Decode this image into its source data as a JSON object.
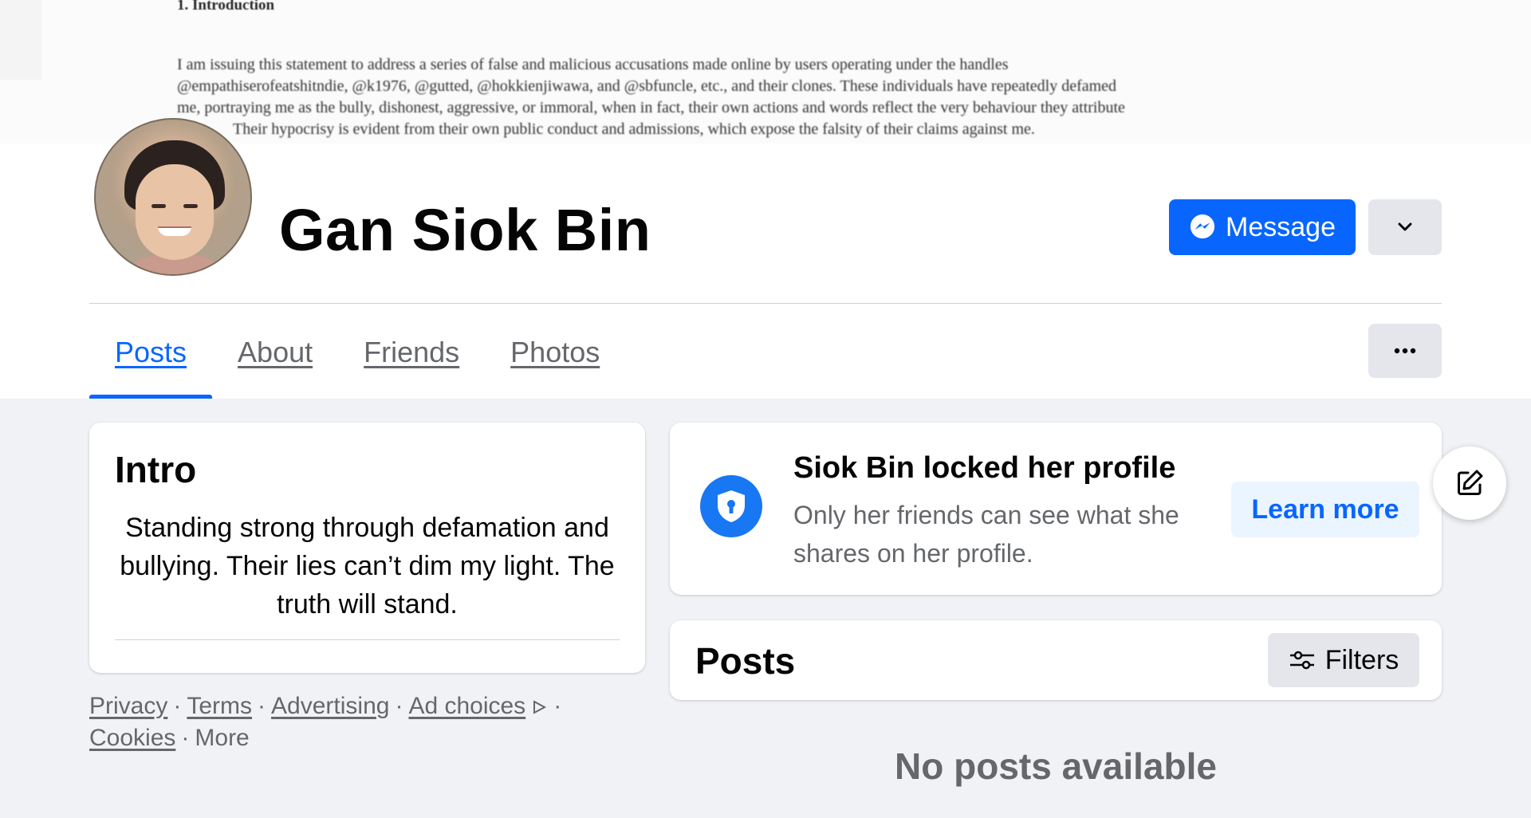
{
  "cover": {
    "heading": "1. Introduction",
    "paragraph_lines": [
      "I am issuing this statement to address a series of false and malicious accusations made online by users operating under the handles",
      "@empathiserofeatshitndie, @k1976, @gutted, @hokkienjiwawa, and @sbfuncle, etc., and their clones. These individuals have repeatedly defamed",
      "me, portraying me as the bully, dishonest, aggressive, or immoral, when in fact, their own actions and words reflect the very behaviour they attribute",
      "Their hypocrisy is evident from their own public conduct and admissions, which expose the falsity of their claims against me."
    ]
  },
  "profile": {
    "name": "Gan Siok Bin",
    "message_label": "Message"
  },
  "tabs": [
    {
      "label": "Posts",
      "active": true
    },
    {
      "label": "About",
      "active": false
    },
    {
      "label": "Friends",
      "active": false
    },
    {
      "label": "Photos",
      "active": false
    }
  ],
  "intro": {
    "title": "Intro",
    "bio": "Standing strong through defamation and bullying. Their lies can’t dim my light. The truth will stand."
  },
  "footer": {
    "links": [
      "Privacy",
      "Terms",
      "Advertising",
      "Ad choices",
      "Cookies"
    ],
    "more": "More",
    "separator": "·"
  },
  "locked": {
    "title": "Siok Bin locked her profile",
    "description": "Only her friends can see what she shares on her profile.",
    "learn_more": "Learn more"
  },
  "posts": {
    "title": "Posts",
    "filters_label": "Filters",
    "empty": "No posts available"
  },
  "colors": {
    "accent": "#0866ff",
    "background": "#f0f2f5",
    "secondary_text": "#65676b",
    "button_gray": "#e4e6eb"
  },
  "icons": [
    "messenger-icon",
    "chevron-down-icon",
    "ellipsis-icon",
    "shield-lock-icon",
    "filter-sliders-icon",
    "edit-icon",
    "ad-choices-icon"
  ]
}
